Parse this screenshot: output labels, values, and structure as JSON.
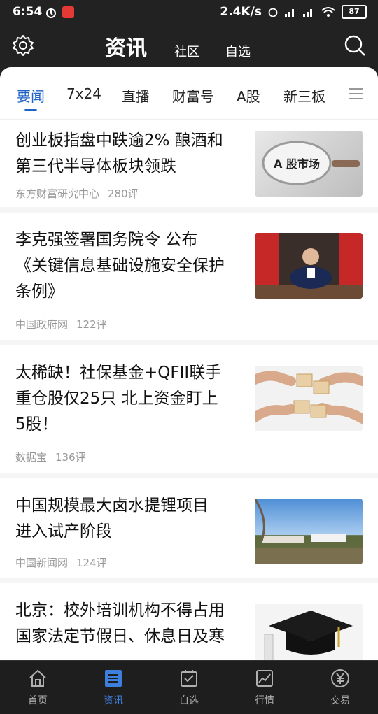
{
  "status_bar": {
    "time": "6:54",
    "network_speed": "2.4K/s",
    "battery": "87",
    "icons": [
      "alarm-icon",
      "app-notification-icon",
      "alarm-icon",
      "signal-icon",
      "signal-icon",
      "wifi-icon",
      "battery-icon"
    ]
  },
  "top_nav": {
    "title": "资讯",
    "community": "社区",
    "watchlist": "自选",
    "settings_icon": "gear-icon",
    "search_icon": "search-icon"
  },
  "tabs": {
    "items": [
      {
        "label": "要闻",
        "active": true
      },
      {
        "label": "7x24"
      },
      {
        "label": "直播"
      },
      {
        "label": "财富号"
      },
      {
        "label": "A股"
      },
      {
        "label": "新三板"
      }
    ],
    "menu_icon": "menu-icon"
  },
  "news": [
    {
      "title_lines": [
        "创业板指盘中跌逾2% 酿酒和",
        "第三代半导体板块领跌"
      ],
      "source": "东方财富研究中心",
      "comments": "280评",
      "thumb_text": "A 股市场"
    },
    {
      "title_lines": [
        "李克强签署国务院令 公布",
        "《关键信息基础设施安全保护",
        "条例》"
      ],
      "source": "中国政府网",
      "comments": "122评"
    },
    {
      "title_lines": [
        "太稀缺！社保基金+QFII联手",
        "重仓股仅25只 北上资金盯上",
        "5股！"
      ],
      "source": "数据宝",
      "comments": "136评"
    },
    {
      "title_lines": [
        "中国规模最大卤水提锂项目",
        "进入试产阶段"
      ],
      "source": "中国新闻网",
      "comments": "124评"
    },
    {
      "title_lines": [
        "北京：校外培训机构不得占用",
        "国家法定节假日、休息日及寒"
      ],
      "source": "",
      "comments": ""
    }
  ],
  "bottom_tabs": [
    {
      "label": "首页",
      "icon": "home-icon"
    },
    {
      "label": "资讯",
      "icon": "news-icon",
      "active": true
    },
    {
      "label": "自选",
      "icon": "watchlist-icon"
    },
    {
      "label": "行情",
      "icon": "market-chart-icon"
    },
    {
      "label": "交易",
      "icon": "yuan-icon"
    }
  ],
  "colors": {
    "accent": "#1f63c6",
    "header_bg": "#222222",
    "bottom_active": "#3d7fdd"
  }
}
